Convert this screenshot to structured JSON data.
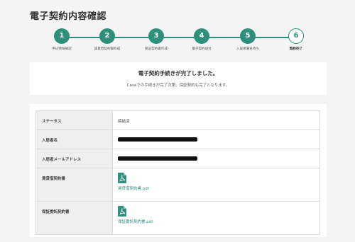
{
  "page": {
    "title": "電子契約内容確認"
  },
  "steps": [
    {
      "number": "1",
      "label": "申込情報確認",
      "status": "done"
    },
    {
      "number": "2",
      "label": "賃貸借契約書作成",
      "status": "done"
    },
    {
      "number": "3",
      "label": "保証契約書作成",
      "status": "done"
    },
    {
      "number": "4",
      "label": "電子契約送付",
      "status": "done"
    },
    {
      "number": "5",
      "label": "入居者署名待ち",
      "status": "done"
    },
    {
      "number": "6",
      "label": "契約完了",
      "status": "current"
    }
  ],
  "notice": {
    "title": "電子契約手続きが完了しました。",
    "text": "Casaでの手続きが完了次第、保証契約も完了となります。"
  },
  "details": {
    "status_label": "ステータス",
    "status_value": "締結済",
    "tenant_name_label": "入居者名",
    "tenant_email_label": "入居者メールアドレス",
    "lease_contract_label": "賃貸借契約書",
    "lease_contract_file": "賃貸借契約書.pdf",
    "guarantee_contract_label": "保証委託契約書",
    "guarantee_contract_file": "保証委託契約書.pdf"
  },
  "colors": {
    "accent": "#2e8f7c",
    "pdf_icon": "#2e8f7c",
    "background": "#f4f4f4"
  },
  "icons": {
    "file": "pdf-file-icon"
  }
}
